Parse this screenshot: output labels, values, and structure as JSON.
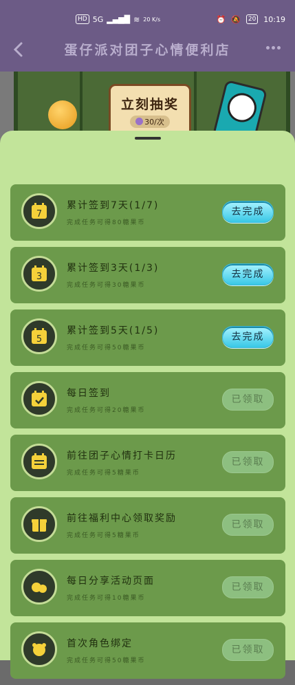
{
  "status": {
    "left": [
      "HD",
      "5G",
      "20 K/s"
    ],
    "battery": "20",
    "time": "10:19"
  },
  "header": {
    "title": "蛋仔派对团子心情便利店"
  },
  "game": {
    "lottery_title": "立刻抽奖",
    "lottery_cost": "30/次"
  },
  "tasks": [
    {
      "name": "累计签到7天(1/7)",
      "desc": "完成任务可得80糖果币",
      "button": "去完成",
      "state": "go",
      "icon": "calendar-7-icon"
    },
    {
      "name": "累计签到3天(1/3)",
      "desc": "完成任务可得30糖果币",
      "button": "去完成",
      "state": "go",
      "icon": "calendar-3-icon"
    },
    {
      "name": "累计签到5天(1/5)",
      "desc": "完成任务可得50糖果币",
      "button": "去完成",
      "state": "go",
      "icon": "calendar-5-icon"
    },
    {
      "name": "每日签到",
      "desc": "完成任务可得20糖果币",
      "button": "已领取",
      "state": "done",
      "icon": "calendar-check-icon"
    },
    {
      "name": "前往团子心情打卡日历",
      "desc": "完成任务可得5糖果币",
      "button": "已领取",
      "state": "done",
      "icon": "calendar-icon"
    },
    {
      "name": "前往福利中心领取奖励",
      "desc": "完成任务可得5糖果币",
      "button": "已领取",
      "state": "done",
      "icon": "gift-icon"
    },
    {
      "name": "每日分享活动页面",
      "desc": "完成任务可得10糖果币",
      "button": "已领取",
      "state": "done",
      "icon": "share-icon"
    },
    {
      "name": "首次角色绑定",
      "desc": "完成任务可得50糖果币",
      "button": "已领取",
      "state": "done",
      "icon": "character-icon"
    }
  ],
  "colors": {
    "header_bg": "#6c5b86",
    "sheet_bg": "#c2e49a",
    "task_bg": "#6c9a4b",
    "go_button": "#39c8e6"
  }
}
